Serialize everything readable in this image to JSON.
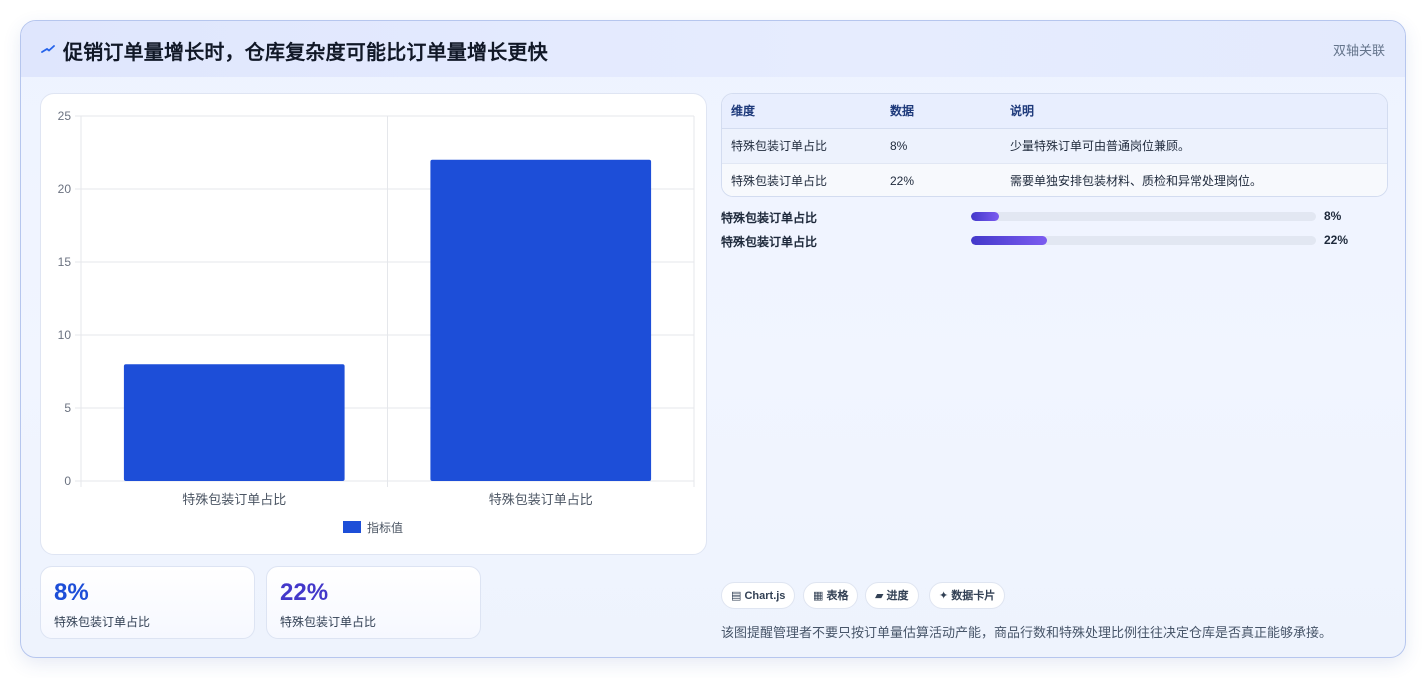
{
  "header": {
    "icon": "trend-icon",
    "title": "促销订单量增长时，仓库复杂度可能比订单量增长更快",
    "tag": "双轴关联"
  },
  "chart_data": {
    "type": "bar",
    "categories": [
      "特殊包装订单占比",
      "特殊包装订单占比"
    ],
    "series": [
      {
        "name": "指标值",
        "values": [
          8,
          22
        ],
        "color": "#1d4ed8"
      }
    ],
    "ylim": [
      0,
      25
    ],
    "yticks": [
      "0",
      "5",
      "10",
      "15",
      "20",
      "25"
    ],
    "grid": true,
    "legend": "bottom"
  },
  "stats": [
    {
      "value": "8%",
      "label": "特殊包装订单占比",
      "color": "#1d4ed8"
    },
    {
      "value": "22%",
      "label": "特殊包装订单占比",
      "color": "#4338ca"
    }
  ],
  "table": {
    "headers": [
      "维度",
      "数据",
      "说明"
    ],
    "rows": [
      [
        "特殊包装订单占比",
        "8%",
        "少量特殊订单可由普通岗位兼顾。"
      ],
      [
        "特殊包装订单占比",
        "22%",
        "需要单独安排包装材料、质检和异常处理岗位。"
      ]
    ]
  },
  "progress": [
    {
      "label": "特殊包装订单占比",
      "value": 0.08,
      "value_label": "8%"
    },
    {
      "label": "特殊包装订单占比",
      "value": 0.22,
      "value_label": "22%"
    }
  ],
  "chips": [
    {
      "icon": "chart-icon",
      "glyph": "▤",
      "label": "Chart.js"
    },
    {
      "icon": "table-icon",
      "glyph": "▦",
      "label": "表格"
    },
    {
      "icon": "progress-icon",
      "glyph": "▰",
      "label": "进度"
    },
    {
      "icon": "sparkle-icon",
      "glyph": "✦",
      "label": "数据卡片"
    }
  ],
  "note": "该图提醒管理者不要只按订单量估算活动产能，商品行数和特殊处理比例往往决定仓库是否真正能够承接。"
}
